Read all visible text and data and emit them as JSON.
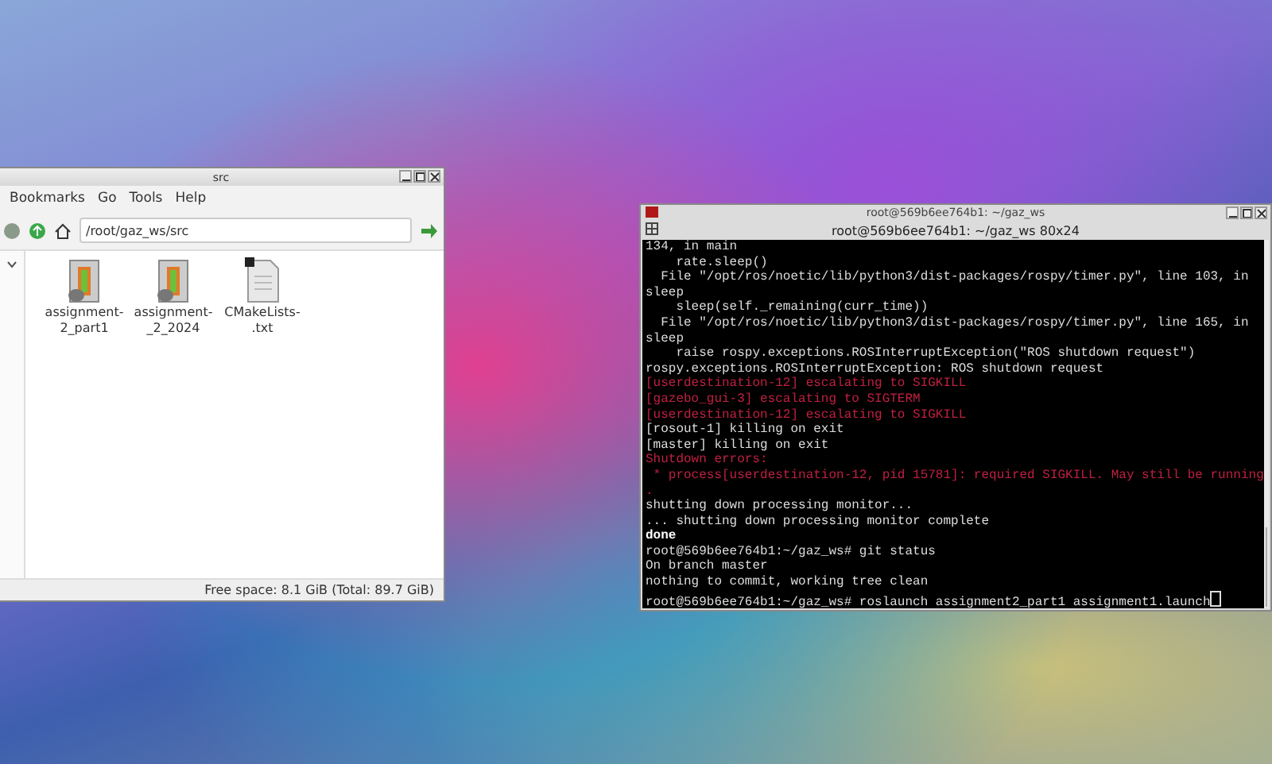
{
  "file_manager": {
    "title": "src",
    "menu": [
      "Bookmarks",
      "Go",
      "Tools",
      "Help"
    ],
    "path": "/root/gaz_ws/src",
    "files": [
      {
        "name": "assignment-\n2_part1",
        "kind": "package"
      },
      {
        "name": "assignment-\n_2_2024",
        "kind": "package"
      },
      {
        "name": "CMakeLists-\n.txt",
        "kind": "text"
      }
    ],
    "status": "Free space: 8.1 GiB (Total: 89.7 GiB)"
  },
  "terminal": {
    "title": "root@569b6ee764b1: ~/gaz_ws",
    "tab_title": "root@569b6ee764b1: ~/gaz_ws 80x24",
    "lines": [
      {
        "text": "134, in main",
        "kind": "normal"
      },
      {
        "text": "    rate.sleep()",
        "kind": "normal"
      },
      {
        "text": "  File \"/opt/ros/noetic/lib/python3/dist-packages/rospy/timer.py\", line 103, in",
        "kind": "normal"
      },
      {
        "text": "sleep",
        "kind": "normal"
      },
      {
        "text": "    sleep(self._remaining(curr_time))",
        "kind": "normal"
      },
      {
        "text": "  File \"/opt/ros/noetic/lib/python3/dist-packages/rospy/timer.py\", line 165, in",
        "kind": "normal"
      },
      {
        "text": "sleep",
        "kind": "normal"
      },
      {
        "text": "    raise rospy.exceptions.ROSInterruptException(\"ROS shutdown request\")",
        "kind": "normal"
      },
      {
        "text": "rospy.exceptions.ROSInterruptException: ROS shutdown request",
        "kind": "normal"
      },
      {
        "text": "[userdestination-12] escalating to SIGKILL",
        "kind": "error"
      },
      {
        "text": "[gazebo_gui-3] escalating to SIGTERM",
        "kind": "error"
      },
      {
        "text": "[userdestination-12] escalating to SIGKILL",
        "kind": "error"
      },
      {
        "text": "[rosout-1] killing on exit",
        "kind": "normal"
      },
      {
        "text": "[master] killing on exit",
        "kind": "normal"
      },
      {
        "text": "Shutdown errors:",
        "kind": "error"
      },
      {
        "text": " * process[userdestination-12, pid 15781]: required SIGKILL. May still be running",
        "kind": "error"
      },
      {
        "text": ".",
        "kind": "error"
      },
      {
        "text": "shutting down processing monitor...",
        "kind": "normal"
      },
      {
        "text": "... shutting down processing monitor complete",
        "kind": "normal"
      },
      {
        "text": "done",
        "kind": "bold"
      },
      {
        "text": "root@569b6ee764b1:~/gaz_ws# git status",
        "kind": "normal"
      },
      {
        "text": "On branch master",
        "kind": "normal"
      },
      {
        "text": "nothing to commit, working tree clean",
        "kind": "normal"
      },
      {
        "text": "root@569b6ee764b1:~/gaz_ws# roslaunch assignment2_part1 assignment1.launch",
        "kind": "prompt"
      }
    ]
  }
}
